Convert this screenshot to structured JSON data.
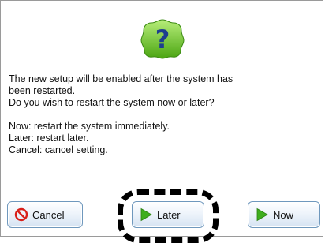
{
  "dialog": {
    "icon": "question-icon",
    "message_lines": [
      "The new setup will be enabled after the system has",
      "been restarted.",
      "Do you wish to restart the system now or later?"
    ],
    "option_lines": [
      "Now: restart the system immediately.",
      "Later: restart later.",
      "Cancel: cancel setting."
    ]
  },
  "buttons": {
    "cancel_label": "Cancel",
    "later_label": "Later",
    "now_label": "Now"
  },
  "colors": {
    "icon_badge": "#58b31a",
    "play_arrow": "#3fae1e",
    "cancel_icon": "#d9201a",
    "button_border": "#6f98bd"
  },
  "focused_button": "Later"
}
